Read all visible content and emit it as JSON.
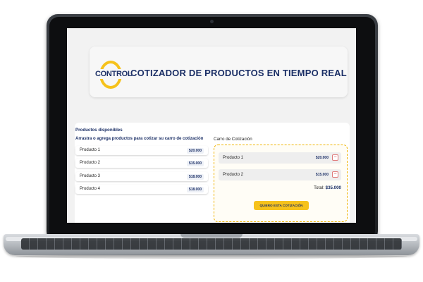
{
  "header": {
    "logo_text": "CONTROL",
    "title": "COTIZADOR DE PRODUCTOS EN TIEMPO REAL"
  },
  "products": {
    "section_title": "Productos disponibles",
    "hint": "Arrastra o agrega productos para cotizar su carro de cotización",
    "items": [
      {
        "name": "Producto 1",
        "price": "$20.000"
      },
      {
        "name": "Producto 2",
        "price": "$15.000"
      },
      {
        "name": "Producto 3",
        "price": "$18.000"
      },
      {
        "name": "Producto 4",
        "price": "$18.000"
      }
    ]
  },
  "cart": {
    "title": "Carro de Cotización",
    "items": [
      {
        "name": "Producto 1",
        "price": "$20.000",
        "remove": "−"
      },
      {
        "name": "Producto 2",
        "price": "$15.000",
        "remove": "−"
      }
    ],
    "total_label": "Total:",
    "total_value": "$35.000",
    "submit_label": "QUIERO ESTA COTIZACIÓN"
  },
  "colors": {
    "brand_navy": "#1b2f66",
    "brand_yellow": "#f6c21c",
    "remove_red": "#d04040"
  }
}
